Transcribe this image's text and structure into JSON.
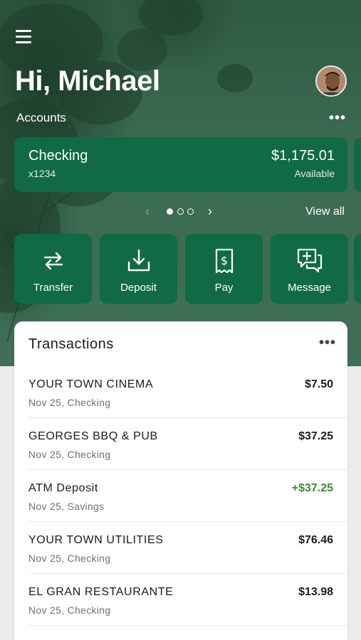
{
  "header": {
    "greeting": "Hi, Michael",
    "menu_icon": "menu-icon",
    "avatar_icon": "avatar"
  },
  "accounts": {
    "label": "Accounts",
    "more_label": "•••",
    "card": {
      "name": "Checking",
      "number": "x1234",
      "balance": "$1,175.01",
      "balance_label": "Available"
    },
    "pager": {
      "prev": "‹",
      "next": "›",
      "page_count": 3,
      "current_page": 1
    },
    "view_all": "View all"
  },
  "actions": [
    {
      "label": "Transfer",
      "icon": "transfer-icon"
    },
    {
      "label": "Deposit",
      "icon": "deposit-icon"
    },
    {
      "label": "Pay",
      "icon": "pay-icon"
    },
    {
      "label": "Message",
      "icon": "message-icon"
    }
  ],
  "transactions": {
    "title": "Transactions",
    "more_label": "•••",
    "items": [
      {
        "merchant": "YOUR TOWN CINEMA",
        "sub": "Nov 25, Checking",
        "amount": "$7.50",
        "credit": false
      },
      {
        "merchant": "GEORGES BBQ & PUB",
        "sub": "Nov 25, Checking",
        "amount": "$37.25",
        "credit": false
      },
      {
        "merchant": "ATM Deposit",
        "sub": "Nov 25, Savings",
        "amount": "+$37.25",
        "credit": true
      },
      {
        "merchant": "YOUR TOWN UTILITIES",
        "sub": "Nov 25, Checking",
        "amount": "$76.46",
        "credit": false
      },
      {
        "merchant": "EL GRAN RESTAURANTE",
        "sub": "Nov 25, Checking",
        "amount": "$13.98",
        "credit": false
      }
    ]
  },
  "colors": {
    "brand_green": "#0f6a45",
    "credit_green": "#3a8a30",
    "hero_green": "#3b6a52"
  }
}
